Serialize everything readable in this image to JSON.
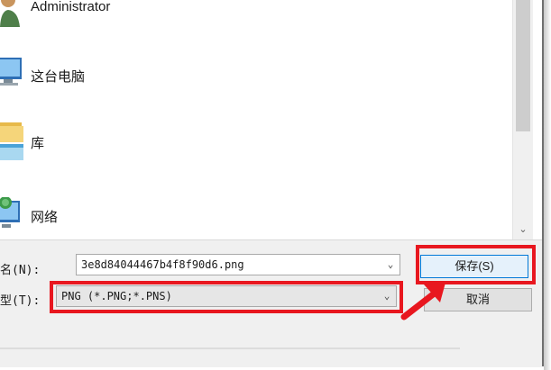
{
  "nav": {
    "items": [
      {
        "label": "Administrator",
        "icon": "user-icon"
      },
      {
        "label": "这台电脑",
        "icon": "computer-icon"
      },
      {
        "label": "库",
        "icon": "library-icon"
      },
      {
        "label": "网络",
        "icon": "network-icon"
      }
    ]
  },
  "scrollbar": {
    "down_arrow": "⌄"
  },
  "form": {
    "filename_label": "名(N):",
    "filename_value": "3e8d84044467b4f8f90d6.png",
    "type_label": "型(T):",
    "type_value": "PNG (*.PNG;*.PNS)"
  },
  "buttons": {
    "save": "保存(S)",
    "cancel": "取消"
  },
  "annotation": {
    "color": "#e8171f"
  }
}
